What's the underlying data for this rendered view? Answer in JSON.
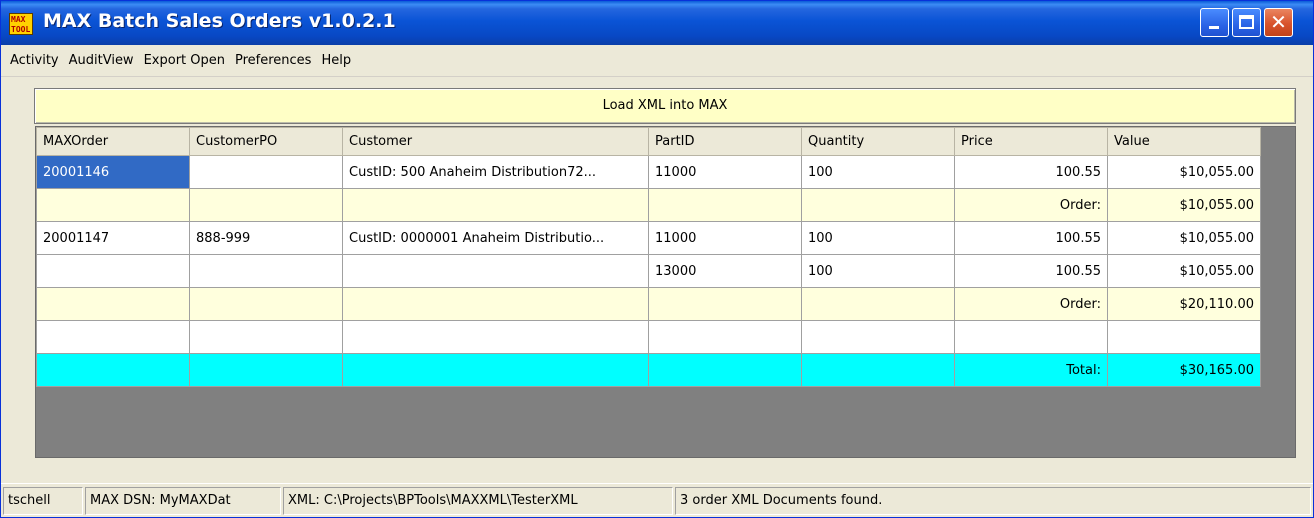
{
  "window": {
    "title": "MAX Batch Sales Orders v1.0.2.1",
    "icon_text_line1": "MAX",
    "icon_text_line2": "TOOL",
    "controls": {
      "minimize_icon": "minimize-icon",
      "maximize_icon": "maximize-icon",
      "close_glyph": "✕"
    }
  },
  "menu": {
    "items": [
      {
        "label": "Activity"
      },
      {
        "label": "AuditView"
      },
      {
        "label": "Export Open"
      },
      {
        "label": "Preferences"
      },
      {
        "label": "Help"
      }
    ]
  },
  "load_button": {
    "label": "Load XML into MAX"
  },
  "grid": {
    "columns": [
      "MAXOrder",
      "CustomerPO",
      "Customer",
      "PartID",
      "Quantity",
      "Price",
      "Value"
    ],
    "rows": [
      {
        "type": "data",
        "cells": [
          "20001146",
          "",
          "CustID: 500 Anaheim Distribution72...",
          "11000",
          "100",
          "100.55",
          "$10,055.00"
        ]
      },
      {
        "type": "subtotal",
        "cells": [
          "",
          "",
          "",
          "",
          "",
          "Order:",
          "$10,055.00"
        ]
      },
      {
        "type": "data",
        "cells": [
          "20001147",
          "888-999",
          "CustID: 0000001 Anaheim Distributio...",
          "11000",
          "100",
          "100.55",
          "$10,055.00"
        ]
      },
      {
        "type": "data",
        "cells": [
          "",
          "",
          "",
          "13000",
          "100",
          "100.55",
          "$10,055.00"
        ]
      },
      {
        "type": "subtotal",
        "cells": [
          "",
          "",
          "",
          "",
          "",
          "Order:",
          "$20,110.00"
        ]
      },
      {
        "type": "data",
        "cells": [
          "",
          "",
          "",
          "",
          "",
          "",
          ""
        ]
      },
      {
        "type": "total",
        "cells": [
          "",
          "",
          "",
          "",
          "",
          "Total:",
          "$30,165.00"
        ]
      }
    ],
    "selected_cell": {
      "row": 0,
      "col": 0
    }
  },
  "status_bar": {
    "user": "tschell",
    "dsn": "MAX DSN: MyMAXDat",
    "xml_path": "XML: C:\\Projects\\BPTools\\MAXXML\\TesterXML",
    "message": "3 order XML Documents found."
  },
  "colors": {
    "title_bar": "#0a54d6",
    "load_button_bg": "#ffffc6",
    "subtotal_row_bg": "#ffffdd",
    "total_row_bg": "#00ffff",
    "selected_cell_bg": "#316ac5"
  }
}
